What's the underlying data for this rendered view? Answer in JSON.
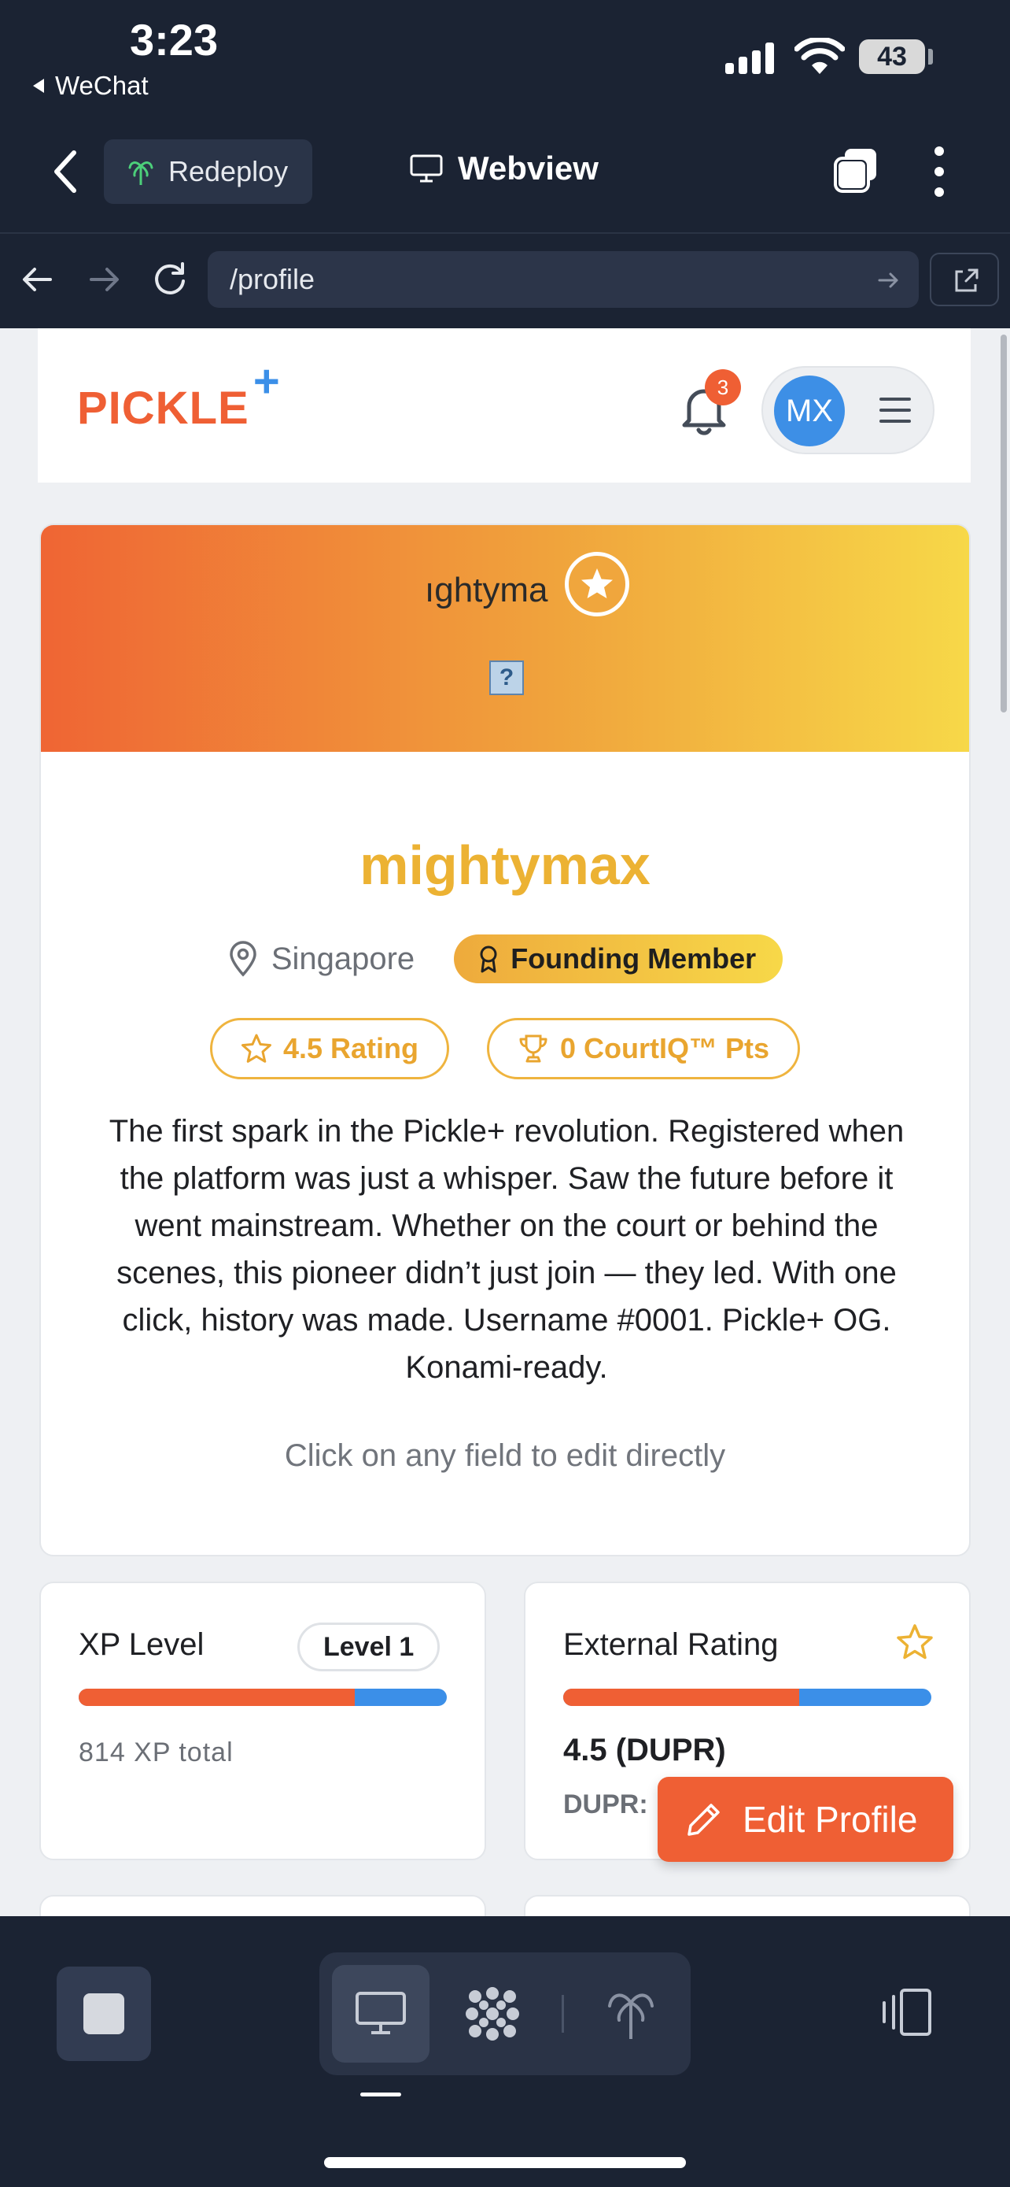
{
  "status_bar": {
    "time": "3:23",
    "back_app": "WeChat",
    "battery": "43"
  },
  "app_header": {
    "redeploy_label": "Redeploy",
    "title": "Webview"
  },
  "browser": {
    "url": "/profile"
  },
  "site": {
    "logo": "PICKLE",
    "logo_plus": "+",
    "notification_count": "3",
    "avatar_initials": "MX"
  },
  "profile": {
    "banner_username": "ıghtyma",
    "banner_placeholder": "?",
    "display_name": "mightymax",
    "location": "Singapore",
    "badge": "Founding Member",
    "rating_pill": "4.5 Rating",
    "courtiq_pill": "0 CourtIQ™ Pts",
    "bio": "The first spark in the Pickle+ revolution. Registered when the platform was just a whisper. Saw the future before it went mainstream. Whether on the court or behind the scenes, this pioneer didn’t just join — they led. With one click, history was made. Username #0001. Pickle+ OG. Konami-ready.",
    "edit_hint": "Click on any field to edit directly"
  },
  "xp_card": {
    "title": "XP Level",
    "level": "Level 1",
    "total": "814 XP total",
    "progress": 0.75
  },
  "rating_card": {
    "title": "External Rating",
    "value": "4.5 (DUPR)",
    "sub": "DUPR:",
    "progress": 0.64
  },
  "edit_button": "Edit Profile",
  "colors": {
    "accent": "#ef5f34",
    "blue": "#3b8fe8",
    "gold": "#ecb233",
    "dark": "#1b2333"
  }
}
